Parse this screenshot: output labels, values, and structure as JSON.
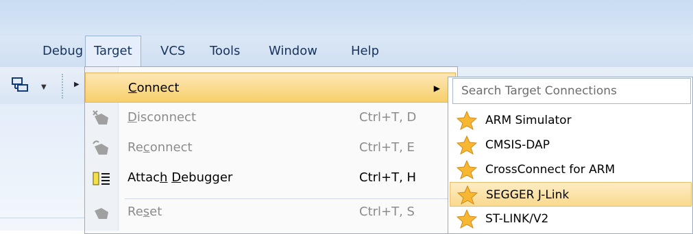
{
  "menubar": {
    "items": [
      {
        "label": "Debug"
      },
      {
        "label": "Target",
        "active": true
      },
      {
        "label": "VCS"
      },
      {
        "label": "Tools"
      },
      {
        "label": "Window"
      },
      {
        "label": "Help"
      }
    ]
  },
  "toolbar": {
    "icons": [
      "layout-icon",
      "dropdown-arrow-icon",
      "separator",
      "overflow-arrow-icon"
    ]
  },
  "target_menu": {
    "items": [
      {
        "label_pre": "",
        "mnemonic": "C",
        "label_post": "onnect",
        "shortcut": "",
        "enabled": true,
        "submenu": true,
        "highlighted": true,
        "icon": ""
      },
      {
        "label_pre": "",
        "mnemonic": "D",
        "label_post": "isconnect",
        "shortcut": "Ctrl+T, D",
        "enabled": false,
        "icon": "disconnect-icon"
      },
      {
        "label_pre": "Re",
        "mnemonic": "c",
        "label_post": "onnect",
        "shortcut": "Ctrl+T, E",
        "enabled": false,
        "icon": "reconnect-icon"
      },
      {
        "label_pre": "Attac",
        "mnemonic": "h",
        "label_post": " Debugger",
        "mnemonic2": "D",
        "shortcut": "Ctrl+T, H",
        "enabled": true,
        "icon": "attach-debugger-icon"
      },
      {
        "label_pre": "Re",
        "mnemonic": "s",
        "label_post": "et",
        "shortcut": "Ctrl+T, S",
        "enabled": false,
        "icon": "reset-icon"
      }
    ]
  },
  "connections_submenu": {
    "search_placeholder": "Search Target Connections",
    "items": [
      {
        "label": "ARM Simulator",
        "icon": "star-icon"
      },
      {
        "label": "CMSIS-DAP",
        "icon": "star-icon"
      },
      {
        "label": "CrossConnect for ARM",
        "icon": "star-icon"
      },
      {
        "label": "SEGGER J-Link",
        "icon": "star-icon",
        "highlighted": true
      },
      {
        "label": "ST-LINK/V2",
        "icon": "star-icon"
      }
    ]
  },
  "colors": {
    "menubar_text": "#15335d",
    "highlight": "#f7cf6a",
    "disabled_text": "#8b8b8b"
  }
}
